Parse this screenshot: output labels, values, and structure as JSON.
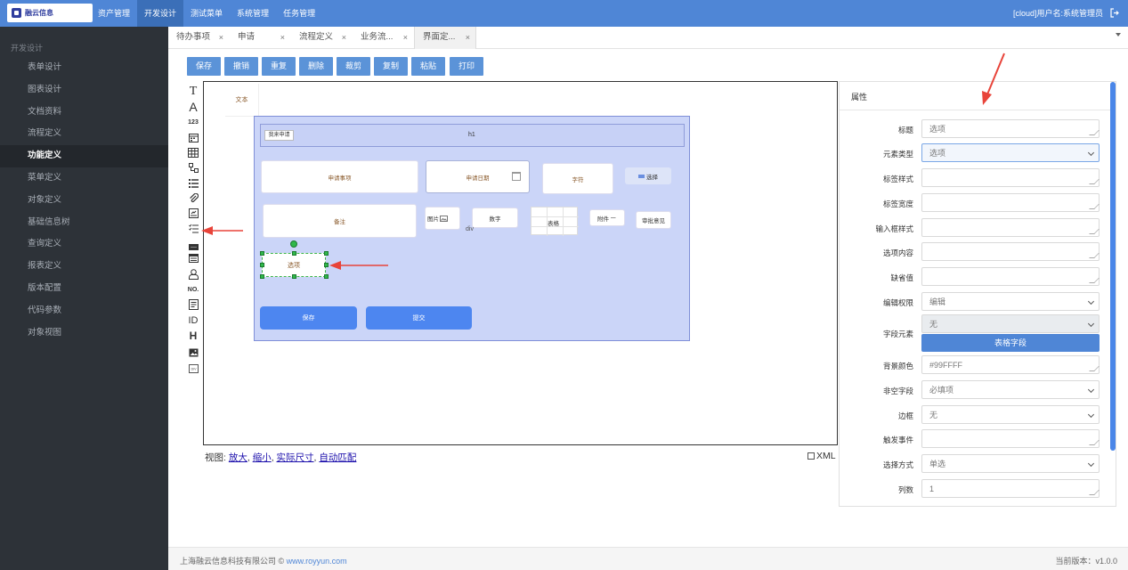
{
  "logo": {
    "text": "融云信息"
  },
  "topnav": {
    "items": [
      "资产管理",
      "开发设计",
      "测试菜单",
      "系统管理",
      "任务管理"
    ],
    "active_index": 1
  },
  "user_info": "[cloud]用户名:系统管理员",
  "sidebar": {
    "section_title": "开发设计",
    "items": [
      "表单设计",
      "图表设计",
      "文档资料",
      "流程定义",
      "功能定义",
      "菜单定义",
      "对象定义",
      "基础信息树",
      "查询定义",
      "报表定义",
      "版本配置",
      "代码参数",
      "对象视图"
    ],
    "active_index": 4
  },
  "tabs": [
    {
      "label": "待办事项",
      "close": "×"
    },
    {
      "label": "申请",
      "close": "×"
    },
    {
      "label": "流程定义",
      "close": "×"
    },
    {
      "label": "业务流...",
      "close": "×"
    },
    {
      "label": "界面定...",
      "close": "×"
    }
  ],
  "toolbar": {
    "save": "保存",
    "undo": "撤销",
    "redo": "重复",
    "delete": "删除",
    "cut": "裁剪",
    "copy": "复制",
    "paste": "粘贴",
    "print": "打印"
  },
  "palette": {
    "text_t": "T",
    "text_a": "A",
    "number": "123",
    "no": "NO.",
    "id": "ID",
    "heading": "H",
    "icons": [
      "text-tool-icon",
      "label-tool-icon",
      "number-tool-icon",
      "date-tool-icon",
      "table-tool-icon",
      "shape-tool-icon",
      "list-tool-icon",
      "attachment-tool-icon",
      "signature-tool-icon",
      "checklist-tool-icon",
      "html-tool-icon",
      "calendar-tool-icon",
      "user-tool-icon",
      "serial-number-tool-icon",
      "document-tool-icon",
      "id-tool-icon",
      "heading-tool-icon",
      "image-tool-icon",
      "div-tool-icon"
    ]
  },
  "canvas": {
    "text_tool": "文本",
    "header_tag": "我来申请",
    "header_title": "h1",
    "fields": {
      "apply_item": "申请事项",
      "apply_date": "申请日期",
      "chars": "字符",
      "select": "选择",
      "remark": "备注",
      "image": "图片",
      "number": "数字",
      "table": "表格",
      "attachment": "附件",
      "approval": "审批意见",
      "option": "选项"
    },
    "div_label": "div",
    "save_button": "保存",
    "submit_button": "提交"
  },
  "view": {
    "label": "视图:",
    "zoom_in": "放大",
    "zoom_out": "缩小",
    "actual": "实际尺寸",
    "auto": "自动匹配",
    "sep": ",",
    "xml": "XML"
  },
  "props": {
    "title": "属性",
    "labels": {
      "title": "标题",
      "element_type": "元素类型",
      "label_style": "标签样式",
      "label_width": "标签宽度",
      "input_style": "输入框样式",
      "options": "选项内容",
      "default": "缺省值",
      "permission": "编辑权限",
      "field_element": "字段元素",
      "bg_color": "背景颜色",
      "required": "非空字段",
      "border": "边框",
      "trigger": "触发事件",
      "select_mode": "选择方式",
      "columns": "列数"
    },
    "values": {
      "title_placeholder": "选项",
      "element_type": "选项",
      "permission": "编辑",
      "field_element": "无",
      "table_field_button": "表格字段",
      "bg_color": "#99FFFF",
      "required": "必填项",
      "border": "无",
      "select_mode": "单选",
      "columns": "1"
    }
  },
  "footer": {
    "company": "上海融云信息科技有限公司 © ",
    "site": "www.royyun.com",
    "version": "当前版本：v1.0.0"
  },
  "colors": {
    "topbar": "#4f86d6",
    "sidebar": "#2d3238",
    "form_area": "#cbd5f8",
    "accent_button": "#4d86f0",
    "arrow": "#e8443a",
    "handle": "#2fb84a"
  }
}
